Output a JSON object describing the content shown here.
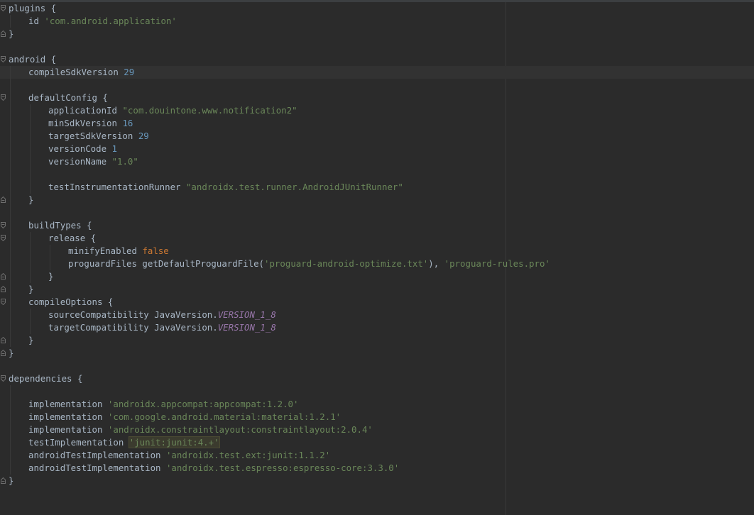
{
  "editor": {
    "language": "groovy",
    "theme_colors": {
      "background": "#2b2b2b",
      "text": "#a9b7c6",
      "keyword": "#cc7832",
      "number": "#6897bb",
      "string": "#6a8759",
      "field": "#9876aa"
    },
    "lines": [
      {
        "indent": 0,
        "tokens": [
          {
            "t": "plugins {",
            "c": "plain"
          }
        ]
      },
      {
        "indent": 1,
        "tokens": [
          {
            "t": "id ",
            "c": "plain"
          },
          {
            "t": "'com.android.application'",
            "c": "str"
          }
        ]
      },
      {
        "indent": 0,
        "tokens": [
          {
            "t": "}",
            "c": "plain"
          }
        ]
      },
      {
        "indent": 0,
        "tokens": []
      },
      {
        "indent": 0,
        "tokens": [
          {
            "t": "android {",
            "c": "plain"
          }
        ]
      },
      {
        "indent": 1,
        "current": true,
        "tokens": [
          {
            "t": "compileSdkVersion ",
            "c": "plain"
          },
          {
            "t": "29",
            "c": "num"
          }
        ]
      },
      {
        "indent": 0,
        "tokens": []
      },
      {
        "indent": 1,
        "tokens": [
          {
            "t": "defaultConfig {",
            "c": "plain"
          }
        ]
      },
      {
        "indent": 2,
        "tokens": [
          {
            "t": "applicationId ",
            "c": "plain"
          },
          {
            "t": "\"com.douintone.www.notification2\"",
            "c": "str"
          }
        ]
      },
      {
        "indent": 2,
        "tokens": [
          {
            "t": "minSdkVersion ",
            "c": "plain"
          },
          {
            "t": "16",
            "c": "num"
          }
        ]
      },
      {
        "indent": 2,
        "tokens": [
          {
            "t": "targetSdkVersion ",
            "c": "plain"
          },
          {
            "t": "29",
            "c": "num"
          }
        ]
      },
      {
        "indent": 2,
        "tokens": [
          {
            "t": "versionCode ",
            "c": "plain"
          },
          {
            "t": "1",
            "c": "num"
          }
        ]
      },
      {
        "indent": 2,
        "tokens": [
          {
            "t": "versionName ",
            "c": "plain"
          },
          {
            "t": "\"1.0\"",
            "c": "str"
          }
        ]
      },
      {
        "indent": 0,
        "tokens": []
      },
      {
        "indent": 2,
        "tokens": [
          {
            "t": "testInstrumentationRunner ",
            "c": "plain"
          },
          {
            "t": "\"androidx.test.runner.AndroidJUnitRunner\"",
            "c": "str"
          }
        ]
      },
      {
        "indent": 1,
        "tokens": [
          {
            "t": "}",
            "c": "plain"
          }
        ]
      },
      {
        "indent": 0,
        "tokens": []
      },
      {
        "indent": 1,
        "tokens": [
          {
            "t": "buildTypes {",
            "c": "plain"
          }
        ]
      },
      {
        "indent": 2,
        "tokens": [
          {
            "t": "release {",
            "c": "plain"
          }
        ]
      },
      {
        "indent": 3,
        "tokens": [
          {
            "t": "minifyEnabled ",
            "c": "plain"
          },
          {
            "t": "false",
            "c": "kw"
          }
        ]
      },
      {
        "indent": 3,
        "tokens": [
          {
            "t": "proguardFiles getDefaultProguardFile(",
            "c": "plain"
          },
          {
            "t": "'proguard-android-optimize.txt'",
            "c": "str"
          },
          {
            "t": "), ",
            "c": "plain"
          },
          {
            "t": "'proguard-rules.pro'",
            "c": "str"
          }
        ]
      },
      {
        "indent": 2,
        "tokens": [
          {
            "t": "}",
            "c": "plain"
          }
        ]
      },
      {
        "indent": 1,
        "tokens": [
          {
            "t": "}",
            "c": "plain"
          }
        ]
      },
      {
        "indent": 1,
        "tokens": [
          {
            "t": "compileOptions {",
            "c": "plain"
          }
        ]
      },
      {
        "indent": 2,
        "tokens": [
          {
            "t": "sourceCompatibility JavaVersion.",
            "c": "plain"
          },
          {
            "t": "VERSION_1_8",
            "c": "field"
          }
        ]
      },
      {
        "indent": 2,
        "tokens": [
          {
            "t": "targetCompatibility JavaVersion.",
            "c": "plain"
          },
          {
            "t": "VERSION_1_8",
            "c": "field"
          }
        ]
      },
      {
        "indent": 1,
        "tokens": [
          {
            "t": "}",
            "c": "plain"
          }
        ]
      },
      {
        "indent": 0,
        "tokens": [
          {
            "t": "}",
            "c": "plain"
          }
        ]
      },
      {
        "indent": 0,
        "tokens": []
      },
      {
        "indent": 0,
        "tokens": [
          {
            "t": "dependencies {",
            "c": "plain"
          }
        ]
      },
      {
        "indent": 0,
        "tokens": []
      },
      {
        "indent": 1,
        "tokens": [
          {
            "t": "implementation ",
            "c": "plain"
          },
          {
            "t": "'androidx.appcompat:appcompat:1.2.0'",
            "c": "str"
          }
        ]
      },
      {
        "indent": 1,
        "tokens": [
          {
            "t": "implementation ",
            "c": "plain"
          },
          {
            "t": "'com.google.android.material:material:1.2.1'",
            "c": "str"
          }
        ]
      },
      {
        "indent": 1,
        "tokens": [
          {
            "t": "implementation ",
            "c": "plain"
          },
          {
            "t": "'androidx.constraintlayout:constraintlayout:2.0.4'",
            "c": "str"
          }
        ]
      },
      {
        "indent": 1,
        "tokens": [
          {
            "t": "testImplementation ",
            "c": "plain"
          },
          {
            "t": "'junit:junit:4.+'",
            "c": "str",
            "highlight": true
          }
        ]
      },
      {
        "indent": 1,
        "tokens": [
          {
            "t": "androidTestImplementation ",
            "c": "plain"
          },
          {
            "t": "'androidx.test.ext:junit:1.1.2'",
            "c": "str"
          }
        ]
      },
      {
        "indent": 1,
        "tokens": [
          {
            "t": "androidTestImplementation ",
            "c": "plain"
          },
          {
            "t": "'androidx.test.espresso:espresso-core:3.3.0'",
            "c": "str"
          }
        ]
      },
      {
        "indent": 0,
        "tokens": [
          {
            "t": "}",
            "c": "plain"
          }
        ]
      }
    ],
    "folds": [
      {
        "line": 0,
        "kind": "open"
      },
      {
        "line": 2,
        "kind": "close"
      },
      {
        "line": 4,
        "kind": "open"
      },
      {
        "line": 7,
        "kind": "open"
      },
      {
        "line": 15,
        "kind": "close"
      },
      {
        "line": 17,
        "kind": "open"
      },
      {
        "line": 18,
        "kind": "open"
      },
      {
        "line": 21,
        "kind": "close"
      },
      {
        "line": 22,
        "kind": "close"
      },
      {
        "line": 23,
        "kind": "open"
      },
      {
        "line": 26,
        "kind": "close"
      },
      {
        "line": 27,
        "kind": "close"
      },
      {
        "line": 29,
        "kind": "open"
      },
      {
        "line": 37,
        "kind": "close"
      }
    ],
    "guides": [
      {
        "col": 0,
        "from": 1,
        "to": 1
      },
      {
        "col": 0,
        "from": 5,
        "to": 26
      },
      {
        "col": 1,
        "from": 8,
        "to": 14
      },
      {
        "col": 1,
        "from": 18,
        "to": 21
      },
      {
        "col": 2,
        "from": 19,
        "to": 20
      },
      {
        "col": 1,
        "from": 24,
        "to": 25
      },
      {
        "col": 0,
        "from": 30,
        "to": 36
      }
    ]
  }
}
